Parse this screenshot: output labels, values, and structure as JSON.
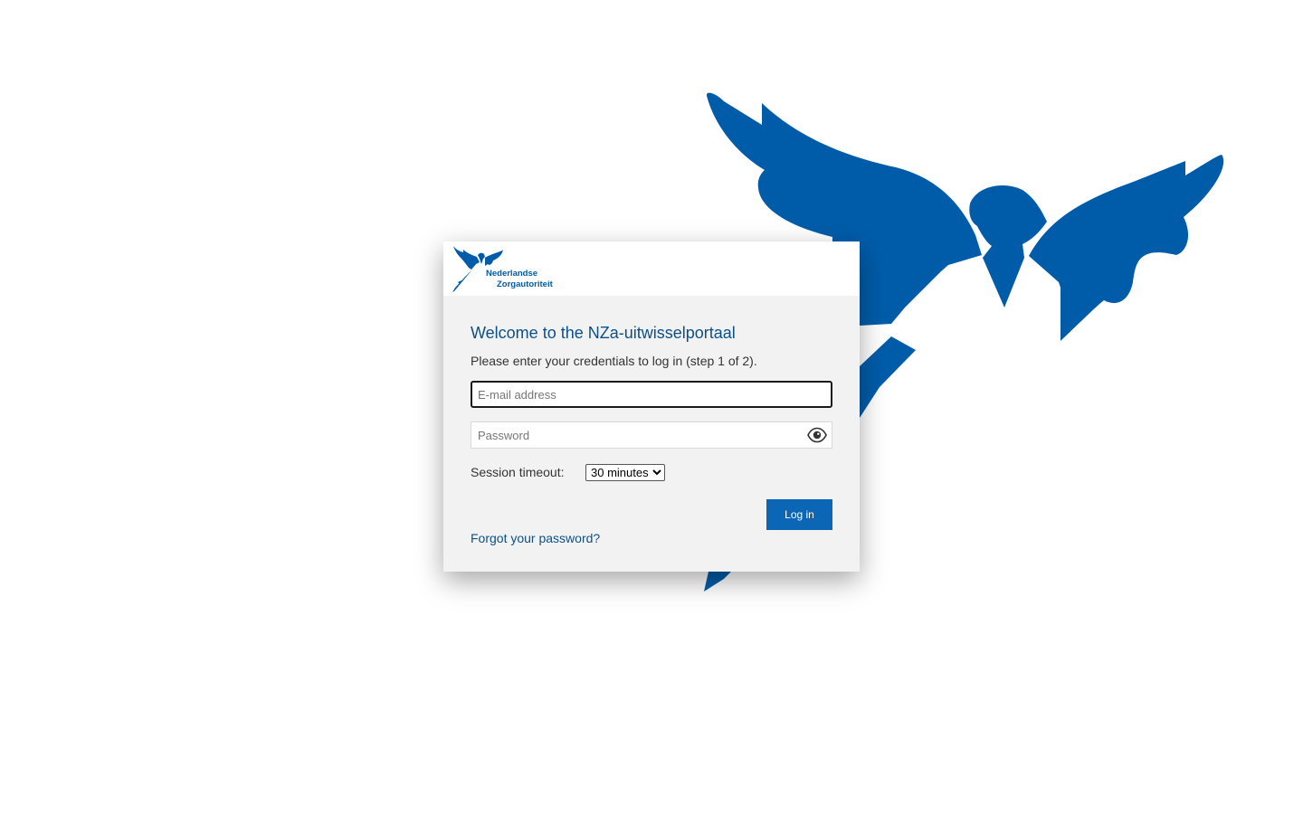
{
  "brand": {
    "logo_line1": "Nederlandse",
    "logo_line2": "Zorgautoriteit",
    "color": "#005ca9"
  },
  "login": {
    "title": "Welcome to the NZa-uitwisselportaal",
    "intro": "Please enter your credentials to log in (step 1 of 2).",
    "email_placeholder": "E-mail address",
    "email_value": "",
    "password_placeholder": "Password",
    "password_value": "",
    "session_label": "Session timeout:",
    "session_selected": "30 minutes",
    "login_button": "Log in",
    "forgot_link": "Forgot your password?"
  },
  "icons": {
    "password_toggle": "eye-icon",
    "background": "angel-illustration"
  }
}
